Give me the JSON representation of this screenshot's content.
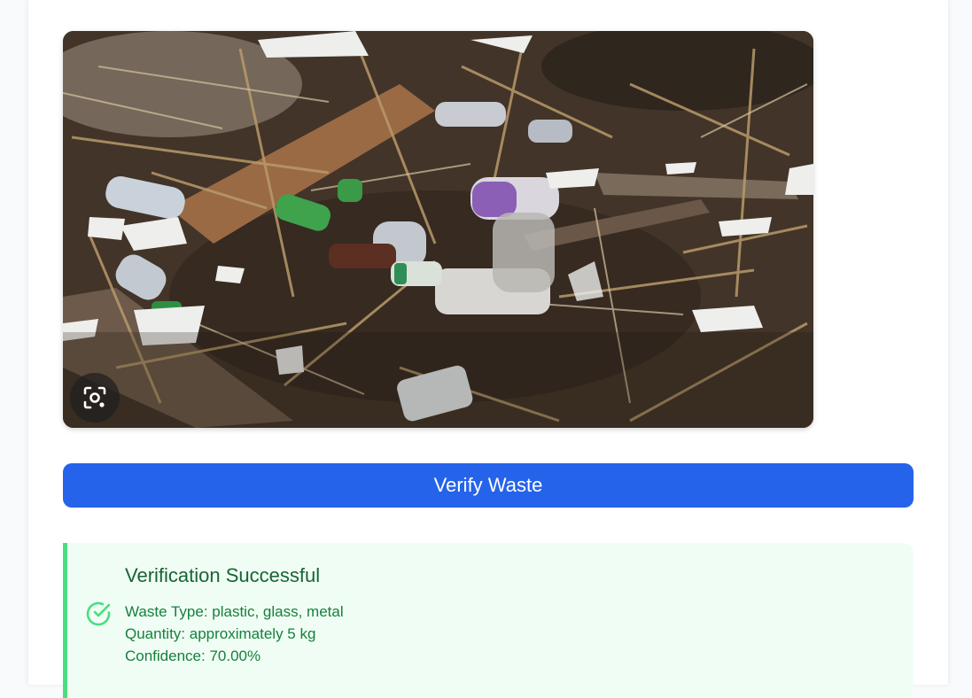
{
  "verify_button": {
    "label": "Verify Waste"
  },
  "result": {
    "title": "Verification Successful",
    "waste_type": "Waste Type: plastic, glass, metal",
    "quantity": "Quantity: approximately 5 kg",
    "confidence": "Confidence: 70.00%"
  },
  "icons": {
    "lens": "lens-search-icon",
    "check": "check-circle-icon"
  },
  "colors": {
    "primary": "#2563eb",
    "success_bg": "#f0fdf4",
    "success_border": "#4ade80",
    "success_title": "#166534",
    "success_text": "#15803d"
  }
}
